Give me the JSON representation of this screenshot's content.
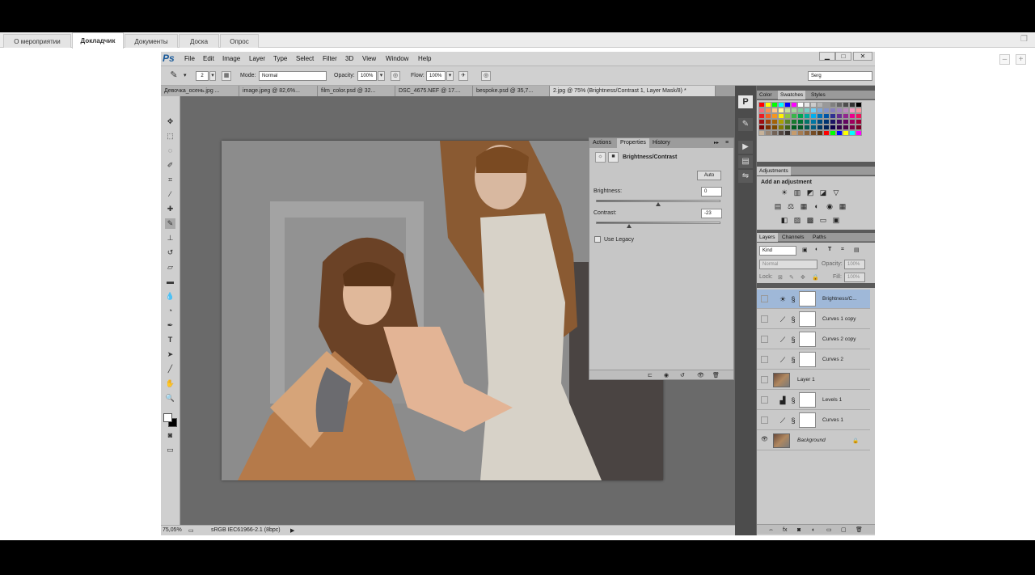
{
  "browser": {
    "tabs": [
      "О мероприятии",
      "Докладчик",
      "Документы",
      "Доска",
      "Опрос"
    ],
    "active_tab": 1,
    "window_icon": "restore-icon",
    "mini_controls": [
      "–",
      "+"
    ]
  },
  "app": {
    "logo": "Ps",
    "menu": [
      "File",
      "Edit",
      "Image",
      "Layer",
      "Type",
      "Select",
      "Filter",
      "3D",
      "View",
      "Window",
      "Help"
    ],
    "window_controls": [
      "▁",
      "□",
      "✕"
    ]
  },
  "options": {
    "brush_size": "2",
    "mode_label": "Mode:",
    "mode_value": "Normal",
    "opacity_label": "Opacity:",
    "opacity_value": "100%",
    "flow_label": "Flow:",
    "flow_value": "100%",
    "workspace": "Serg"
  },
  "doc_tabs": [
    "Девочка_осень.jpg ...",
    "image.jpeg @ 82,6%...",
    "film_color.psd @ 32...",
    "DSC_4675.NEF @ 17....",
    "bespoke.psd @ 35,7...",
    "2.jpg @ 75% (Brightness/Contrast 1, Layer Mask/8) *"
  ],
  "tools": [
    "move",
    "marquee",
    "lasso",
    "quick-select",
    "crop",
    "eyedropper",
    "healing",
    "brush",
    "stamp",
    "history-brush",
    "eraser",
    "gradient",
    "blur",
    "dodge",
    "pen",
    "type",
    "path-select",
    "line",
    "hand",
    "zoom"
  ],
  "status": {
    "zoom": "75,05%",
    "profile": "sRGB IEC61966-2.1 (8bpc)"
  },
  "properties": {
    "tabs": [
      "Actions",
      "Properties",
      "History"
    ],
    "active_tab": 1,
    "title": "Brightness/Contrast",
    "auto_label": "Auto",
    "brightness_label": "Brightness:",
    "brightness_value": "0",
    "contrast_label": "Contrast:",
    "contrast_value": "-23",
    "legacy_label": "Use Legacy"
  },
  "color_panel": {
    "tabs": [
      "Color",
      "Swatches",
      "Styles"
    ],
    "active_tab": 1,
    "swatches": [
      "#ff0000",
      "#ffff00",
      "#00ff00",
      "#00ffff",
      "#0000ff",
      "#ff00ff",
      "#ffffff",
      "#e6e6e6",
      "#cccccc",
      "#b3b3b3",
      "#999999",
      "#808080",
      "#666666",
      "#4d4d4d",
      "#333333",
      "#000000",
      "#f26d7d",
      "#f68e56",
      "#fdc689",
      "#fff799",
      "#c4df9b",
      "#a3d39c",
      "#82ca9c",
      "#7accc8",
      "#6dcff6",
      "#7da7d9",
      "#8393ca",
      "#8781bd",
      "#a186be",
      "#bd8cbf",
      "#f49ac1",
      "#f5989d",
      "#ed1c24",
      "#f26522",
      "#f7941d",
      "#fff200",
      "#8dc63f",
      "#39b54a",
      "#00a651",
      "#00a99d",
      "#00aeef",
      "#0072bc",
      "#0054a6",
      "#2e3192",
      "#662d91",
      "#92278f",
      "#ec008c",
      "#ed145b",
      "#9e0b0f",
      "#a0410d",
      "#a36209",
      "#aba000",
      "#598527",
      "#1a7b30",
      "#007236",
      "#00746b",
      "#0076a3",
      "#004b80",
      "#003471",
      "#1b1464",
      "#440e62",
      "#630460",
      "#9e005d",
      "#9e0039",
      "#790000",
      "#7b2e00",
      "#7d4900",
      "#827b00",
      "#406618",
      "#005e20",
      "#005826",
      "#005952",
      "#005b7f",
      "#003663",
      "#002157",
      "#0d004c",
      "#32004b",
      "#4b0049",
      "#7b0046",
      "#7a0026",
      "#c7b299",
      "#998675",
      "#736357",
      "#534741",
      "#37302d",
      "#c69c6d",
      "#a67c52",
      "#8c6239",
      "#754c24",
      "#603913",
      "#ff0000",
      "#00ff00",
      "#0000ff",
      "#ffff00",
      "#00ffff",
      "#ff00ff"
    ]
  },
  "adjustments": {
    "tab": "Adjustments",
    "add_label": "Add an adjustment",
    "row1": [
      "☀",
      "▥",
      "◩",
      "◪",
      "▽"
    ],
    "row2": [
      "▤",
      "⚖",
      "▦",
      "◐",
      "◉",
      "▦"
    ],
    "row3": [
      "◧",
      "▨",
      "▩",
      "▭",
      "▣"
    ]
  },
  "layers": {
    "tabs": [
      "Layers",
      "Channels",
      "Paths"
    ],
    "active_tab": 0,
    "kind_label": "Kind",
    "blend": "Normal",
    "opacity_label": "Opacity:",
    "opacity_value": "100%",
    "lock_label": "Lock:",
    "fill_label": "Fill:",
    "fill_value": "100%",
    "items": [
      {
        "name": "Brightness/C...",
        "icon": "☀",
        "type": "adjust",
        "visible": false,
        "selected": true
      },
      {
        "name": "Curves 1 copy",
        "icon": "⟋",
        "type": "adjust",
        "visible": false,
        "selected": false
      },
      {
        "name": "Curves 2 copy",
        "icon": "⟋",
        "type": "adjust",
        "visible": false,
        "selected": false
      },
      {
        "name": "Curves 2",
        "icon": "⟋",
        "type": "adjust",
        "visible": false,
        "selected": false
      },
      {
        "name": "Layer 1",
        "icon": "",
        "type": "pixel",
        "visible": false,
        "selected": false
      },
      {
        "name": "Levels 1",
        "icon": "▟",
        "type": "adjust",
        "visible": false,
        "selected": false
      },
      {
        "name": "Curves 1",
        "icon": "⟋",
        "type": "adjust",
        "visible": false,
        "selected": false
      },
      {
        "name": "Background",
        "icon": "",
        "type": "pixel",
        "visible": true,
        "selected": false
      }
    ]
  }
}
